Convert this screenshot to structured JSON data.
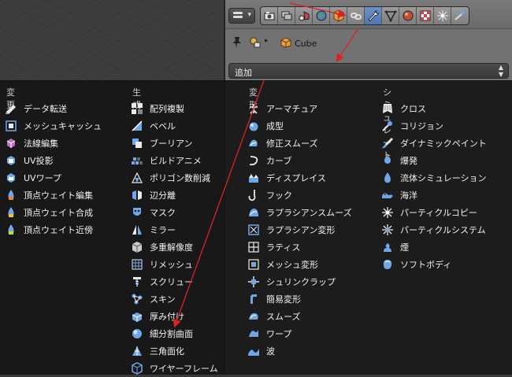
{
  "header": {
    "tabs": [
      {
        "icon": "render-camera-icon"
      },
      {
        "icon": "render-layers-icon"
      },
      {
        "icon": "scene-icon"
      },
      {
        "icon": "world-icon"
      },
      {
        "icon": "object-icon"
      },
      {
        "icon": "constraints-icon"
      },
      {
        "icon": "modifiers-wrench-icon",
        "active": true
      },
      {
        "icon": "object-data-icon"
      },
      {
        "icon": "material-icon"
      },
      {
        "icon": "texture-icon"
      },
      {
        "icon": "particles-icon"
      },
      {
        "icon": "physics-icon"
      }
    ]
  },
  "context": {
    "object_name": "Cube"
  },
  "add_dropdown": {
    "label": "追加"
  },
  "menu": {
    "columns": [
      {
        "title": "変更",
        "items": [
          {
            "label": "データ転送",
            "icon": "data-transfer-icon"
          },
          {
            "label": "メッシュキャッシュ",
            "icon": "mesh-cache-icon"
          },
          {
            "label": "法線編集",
            "icon": "normal-edit-icon"
          },
          {
            "label": "UV投影",
            "icon": "uv-project-icon"
          },
          {
            "label": "UVワープ",
            "icon": "uv-warp-icon"
          },
          {
            "label": "頂点ウェイト編集",
            "icon": "vertex-weight-edit-icon"
          },
          {
            "label": "頂点ウェイト合成",
            "icon": "vertex-weight-mix-icon"
          },
          {
            "label": "頂点ウェイト近傍",
            "icon": "vertex-weight-proximity-icon"
          }
        ]
      },
      {
        "title": "生成",
        "items": [
          {
            "label": "配列複製",
            "icon": "array-icon"
          },
          {
            "label": "ベベル",
            "icon": "bevel-icon"
          },
          {
            "label": "ブーリアン",
            "icon": "boolean-icon"
          },
          {
            "label": "ビルドアニメ",
            "icon": "build-icon"
          },
          {
            "label": "ポリゴン数削減",
            "icon": "decimate-icon"
          },
          {
            "label": "辺分離",
            "icon": "edge-split-icon"
          },
          {
            "label": "マスク",
            "icon": "mask-icon"
          },
          {
            "label": "ミラー",
            "icon": "mirror-icon"
          },
          {
            "label": "多重解像度",
            "icon": "multiresolution-icon"
          },
          {
            "label": "リメッシュ",
            "icon": "remesh-icon"
          },
          {
            "label": "スクリュー",
            "icon": "screw-icon"
          },
          {
            "label": "スキン",
            "icon": "skin-icon"
          },
          {
            "label": "厚み付け",
            "icon": "solidify-icon"
          },
          {
            "label": "細分割曲面",
            "icon": "subdivision-surface-icon"
          },
          {
            "label": "三角面化",
            "icon": "triangulate-icon"
          },
          {
            "label": "ワイヤーフレーム",
            "icon": "wireframe-icon"
          }
        ]
      },
      {
        "title": "変形",
        "items": [
          {
            "label": "アーマチュア",
            "icon": "armature-icon"
          },
          {
            "label": "成型",
            "icon": "cast-icon"
          },
          {
            "label": "修正スムーズ",
            "icon": "corrective-smooth-icon"
          },
          {
            "label": "カーブ",
            "icon": "curve-icon"
          },
          {
            "label": "ディスプレイス",
            "icon": "displace-icon"
          },
          {
            "label": "フック",
            "icon": "hook-icon"
          },
          {
            "label": "ラプラシアンスムーズ",
            "icon": "laplacian-smooth-icon"
          },
          {
            "label": "ラプラシアン変形",
            "icon": "laplacian-deform-icon"
          },
          {
            "label": "ラティス",
            "icon": "lattice-icon"
          },
          {
            "label": "メッシュ変形",
            "icon": "mesh-deform-icon"
          },
          {
            "label": "シュリンクラップ",
            "icon": "shrinkwrap-icon"
          },
          {
            "label": "簡易変形",
            "icon": "simple-deform-icon"
          },
          {
            "label": "スムーズ",
            "icon": "smooth-icon"
          },
          {
            "label": "ワープ",
            "icon": "warp-icon"
          },
          {
            "label": "波",
            "icon": "wave-icon"
          }
        ]
      },
      {
        "title": "シミュレート",
        "items": [
          {
            "label": "クロス",
            "icon": "cloth-icon"
          },
          {
            "label": "コリジョン",
            "icon": "collision-icon"
          },
          {
            "label": "ダイナミックペイント",
            "icon": "dynamic-paint-icon"
          },
          {
            "label": "爆発",
            "icon": "explode-icon"
          },
          {
            "label": "流体シミュレーション",
            "icon": "fluid-simulation-icon"
          },
          {
            "label": "海洋",
            "icon": "ocean-icon"
          },
          {
            "label": "パーティクルコピー",
            "icon": "particle-instance-icon"
          },
          {
            "label": "パーティクルシステム",
            "icon": "particle-system-icon"
          },
          {
            "label": "煙",
            "icon": "smoke-icon"
          },
          {
            "label": "ソフトボディ",
            "icon": "soft-body-icon"
          }
        ]
      }
    ]
  }
}
